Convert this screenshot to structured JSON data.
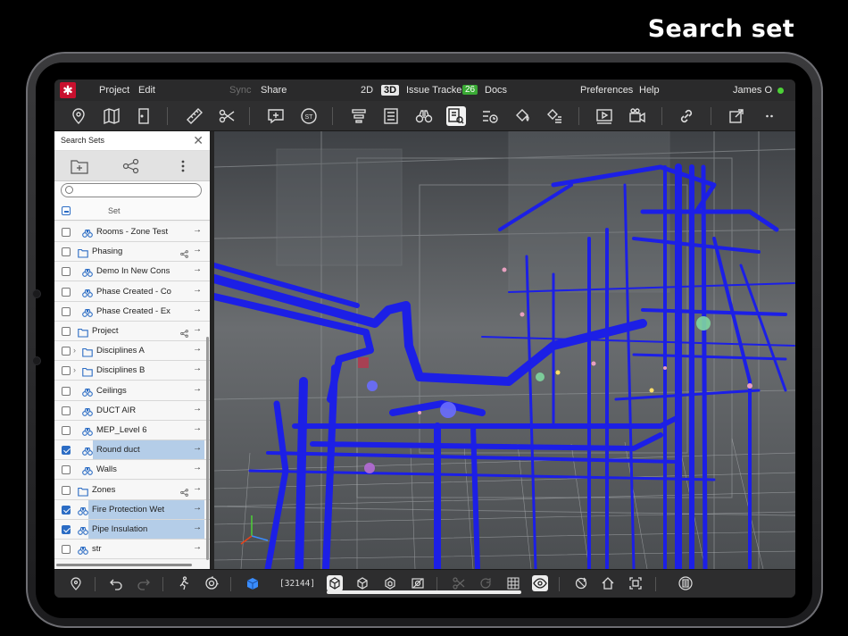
{
  "heading": "Search set",
  "menubar": {
    "project": "Project",
    "edit": "Edit",
    "sync": "Sync",
    "share": "Share",
    "mode_2d": "2D",
    "mode_3d": "3D",
    "issue_tracker": "Issue Tracker",
    "issue_count": "26",
    "docs": "Docs",
    "preferences": "Preferences",
    "help": "Help",
    "user": "James O"
  },
  "toolbar": {
    "icons": [
      "location-pin-icon",
      "map-icon",
      "door-icon",
      "ruler-icon",
      "scissors-icon",
      "add-comment-icon",
      "st-icon",
      "layers-icon",
      "list-icon",
      "binoculars-icon",
      "search-sets-icon",
      "properties-icon",
      "paint-bucket-icon",
      "paint-list-icon",
      "video-player-icon",
      "camera-icon",
      "link-icon",
      "export-icon",
      "more-icon"
    ],
    "st_label": "ST"
  },
  "panel": {
    "title": "Search Sets",
    "search_placeholder": "",
    "header_label": "Set",
    "rows": [
      {
        "label": "Rooms - Zone Test",
        "type": "set",
        "checked": false,
        "indent": 1
      },
      {
        "label": "Phasing",
        "type": "folder",
        "checked": false,
        "indent": 0,
        "shared": true
      },
      {
        "label": "Demo In New Cons",
        "type": "set",
        "checked": false,
        "indent": 1
      },
      {
        "label": "Phase Created - Co",
        "type": "set",
        "checked": false,
        "indent": 1
      },
      {
        "label": "Phase Created - Ex",
        "type": "set",
        "checked": false,
        "indent": 1
      },
      {
        "label": "Project",
        "type": "folder",
        "checked": false,
        "indent": 0,
        "shared": true
      },
      {
        "label": "Disciplines A",
        "type": "folder",
        "checked": false,
        "indent": 1,
        "caret": true
      },
      {
        "label": "Disciplines B",
        "type": "folder",
        "checked": false,
        "indent": 1,
        "caret": true
      },
      {
        "label": "Ceilings",
        "type": "set",
        "checked": false,
        "indent": 1
      },
      {
        "label": "DUCT AIR",
        "type": "set",
        "checked": false,
        "indent": 1
      },
      {
        "label": "MEP_Level 6",
        "type": "set",
        "checked": false,
        "indent": 1
      },
      {
        "label": "Round duct",
        "type": "set",
        "checked": true,
        "indent": 1
      },
      {
        "label": "Walls",
        "type": "set",
        "checked": false,
        "indent": 1
      },
      {
        "label": "Zones",
        "type": "folder",
        "checked": false,
        "indent": 0,
        "shared": true
      },
      {
        "label": "Fire Protection Wet",
        "type": "set",
        "checked": true,
        "indent": 0
      },
      {
        "label": "Pipe Insulation",
        "type": "set",
        "checked": true,
        "indent": 0
      },
      {
        "label": "str",
        "type": "set",
        "checked": false,
        "indent": 0
      }
    ]
  },
  "bottombar": {
    "counter": "[32144]"
  },
  "colors": {
    "accent": "#2b6cc4",
    "highlight": "#b4cde8",
    "pipe_blue": "#1a1ee0",
    "brand_red": "#c8102e",
    "issue_green": "#3aaa35"
  }
}
